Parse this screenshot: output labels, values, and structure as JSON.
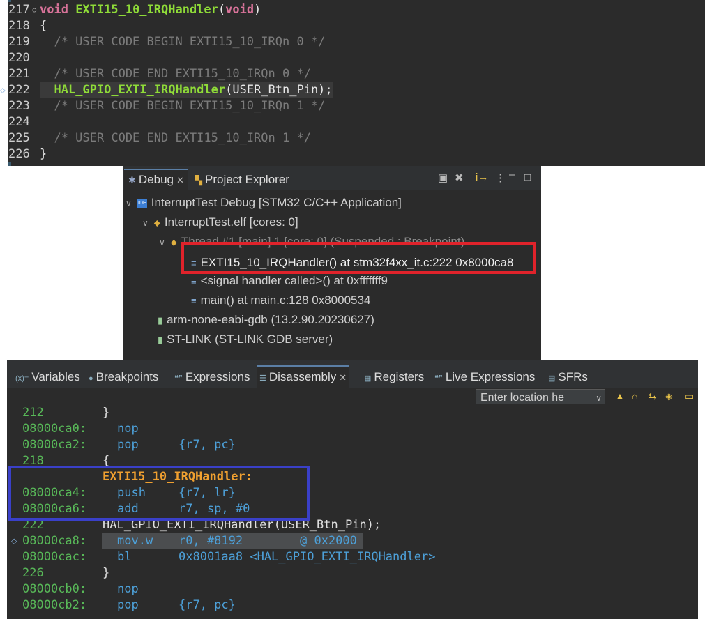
{
  "editor": {
    "lines": [
      {
        "num": "217",
        "parts": [
          {
            "t": "void ",
            "c": "kw"
          },
          {
            "t": "EXTI15_10_IRQHandler",
            "c": "fn"
          },
          {
            "t": "(",
            "c": "tx"
          },
          {
            "t": "void",
            "c": "kw"
          },
          {
            "t": ")",
            "c": "tx"
          }
        ],
        "fold": "⊖"
      },
      {
        "num": "218",
        "parts": [
          {
            "t": "{",
            "c": "tx"
          }
        ]
      },
      {
        "num": "219",
        "parts": [
          {
            "t": "  /* USER CODE BEGIN EXTI15_10_IRQn 0 */",
            "c": "cm"
          }
        ]
      },
      {
        "num": "220",
        "parts": []
      },
      {
        "num": "221",
        "parts": [
          {
            "t": "  /* USER CODE END EXTI15_10_IRQn 0 */",
            "c": "cm"
          }
        ]
      },
      {
        "num": "222",
        "parts": [
          {
            "t": "  ",
            "c": "tx"
          },
          {
            "t": "HAL_GPIO_EXTI_IRQHandler",
            "c": "fn"
          },
          {
            "t": "(USER_Btn_Pin);",
            "c": "tx"
          }
        ],
        "highlight": true,
        "marker": "⬦"
      },
      {
        "num": "223",
        "parts": [
          {
            "t": "  /* USER CODE BEGIN EXTI15_10_IRQn 1 */",
            "c": "cm"
          }
        ]
      },
      {
        "num": "224",
        "parts": []
      },
      {
        "num": "225",
        "parts": [
          {
            "t": "  /* USER CODE END EXTI15_10_IRQn 1 */",
            "c": "cm"
          }
        ]
      },
      {
        "num": "226",
        "parts": [
          {
            "t": "}",
            "c": "tx"
          }
        ]
      }
    ]
  },
  "debug": {
    "tabs": [
      {
        "label": "Debug",
        "icon": "debug-icon",
        "active": true
      },
      {
        "label": "Project Explorer",
        "icon": "project-explorer-icon",
        "active": false
      }
    ],
    "tree": {
      "launch": "InterruptTest Debug [STM32 C/C++ Application]",
      "elf": "InterruptTest.elf [cores: 0]",
      "thread": "Thread #1 [main] 1 [core: 0] (Suspended : Breakpoint)",
      "frames": [
        "EXTI15_10_IRQHandler() at stm32f4xx_it.c:222 0x8000ca8",
        "<signal handler called>() at 0xfffffff9",
        "main() at main.c:128 0x8000534"
      ],
      "gdb": "arm-none-eabi-gdb (13.2.90.20230627)",
      "stlink": "ST-LINK (ST-LINK GDB server)"
    }
  },
  "bottom": {
    "tabs": [
      {
        "label": "Variables",
        "icon": "variables-icon"
      },
      {
        "label": "Breakpoints",
        "icon": "breakpoints-icon"
      },
      {
        "label": "Expressions",
        "icon": "expressions-icon"
      },
      {
        "label": "Disassembly",
        "icon": "disassembly-icon",
        "active": true
      },
      {
        "label": "Registers",
        "icon": "registers-icon"
      },
      {
        "label": "Live Expressions",
        "icon": "live-expressions-icon"
      },
      {
        "label": "SFRs",
        "icon": "sfrs-icon"
      }
    ],
    "location_placeholder": "Enter location he",
    "lines": [
      {
        "kind": "src",
        "num": "212",
        "text": "}"
      },
      {
        "kind": "asm",
        "addr": "08000ca0:",
        "instr": "nop",
        "ops": ""
      },
      {
        "kind": "asm",
        "addr": "08000ca2:",
        "instr": "pop",
        "ops": "{r7, pc}"
      },
      {
        "kind": "src",
        "num": "218",
        "text": "{"
      },
      {
        "kind": "label",
        "text": "EXTI15_10_IRQHandler:"
      },
      {
        "kind": "asm",
        "addr": "08000ca4:",
        "instr": "push",
        "ops": "{r7, lr}"
      },
      {
        "kind": "asm",
        "addr": "08000ca6:",
        "instr": "add",
        "ops": "r7, sp, #0"
      },
      {
        "kind": "src",
        "num": "222",
        "text": "HAL_GPIO_EXTI_IRQHandler(USER_Btn_Pin);"
      },
      {
        "kind": "asm",
        "addr": "08000ca8:",
        "instr": "mov.w",
        "ops": "r0, #8192        @ 0x2000",
        "selected": true
      },
      {
        "kind": "asm",
        "addr": "08000cac:",
        "instr": "bl",
        "ops": "0x8001aa8 <HAL_GPIO_EXTI_IRQHandler>"
      },
      {
        "kind": "src",
        "num": "226",
        "text": "}"
      },
      {
        "kind": "asm",
        "addr": "08000cb0:",
        "instr": "nop",
        "ops": ""
      },
      {
        "kind": "asm",
        "addr": "08000cb2:",
        "instr": "pop",
        "ops": "{r7, pc}"
      }
    ]
  },
  "colors": {
    "red_box": "#e0232b",
    "blue_box": "#3a40c8"
  }
}
